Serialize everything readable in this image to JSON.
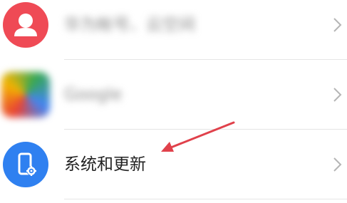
{
  "settings_list": {
    "items": [
      {
        "label": "华为帐号、云空间",
        "icon": "user-avatar-icon",
        "icon_color": "#ef4a55",
        "blurred": true
      },
      {
        "label": "Google",
        "icon": "google-icon",
        "blurred": true
      },
      {
        "label": "系统和更新",
        "icon": "phone-gear-icon",
        "icon_color": "#2f80f0",
        "blurred": false
      }
    ]
  },
  "annotation": {
    "arrow_color": "#e0414b",
    "points_to": "系统和更新"
  }
}
